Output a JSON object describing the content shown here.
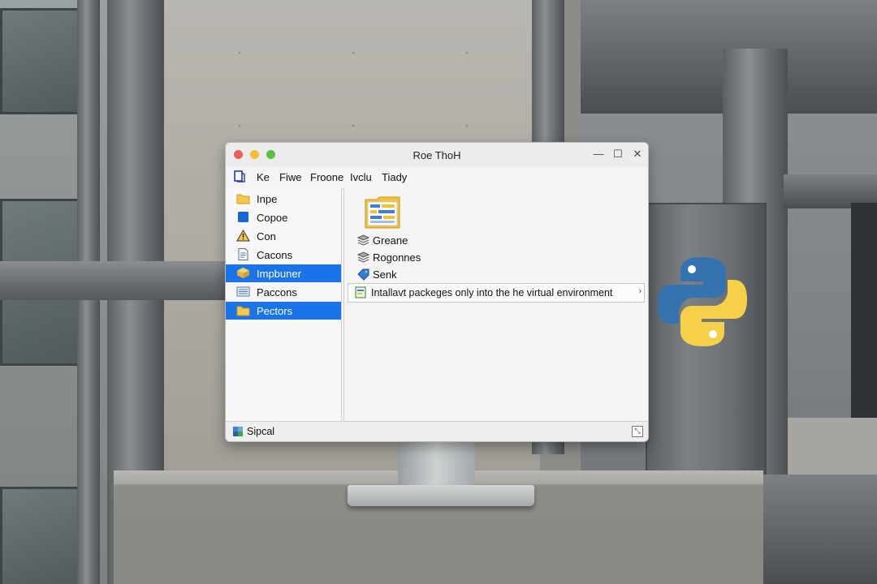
{
  "window": {
    "title": "Roe ThoH",
    "controls": {
      "minimize": "—",
      "maximize": "☐",
      "close": "✕"
    }
  },
  "menubar": {
    "items": [
      "Ke",
      "Fiwe",
      "Froone",
      "Ivclu",
      "Tiady"
    ]
  },
  "sidebar": {
    "items": [
      {
        "label": "Inpe",
        "icon": "folder-icon",
        "selected": false
      },
      {
        "label": "Copoe",
        "icon": "blue-square-icon",
        "selected": false
      },
      {
        "label": "Con",
        "icon": "warning-icon",
        "selected": false
      },
      {
        "label": "Cacons",
        "icon": "document-icon",
        "selected": false
      },
      {
        "label": "Impbuner",
        "icon": "package-icon",
        "selected": true
      },
      {
        "label": "Paccons",
        "icon": "list-icon",
        "selected": false
      },
      {
        "label": "Pectors",
        "icon": "folder-icon",
        "selected": true
      }
    ]
  },
  "content": {
    "items": [
      {
        "label": "Greane",
        "icon": "stack-icon"
      },
      {
        "label": "Rogonnes",
        "icon": "stack-icon"
      },
      {
        "label": "Senk",
        "icon": "tag-icon"
      }
    ],
    "tooltip": "Intallavt packeges only into the he virtual environment"
  },
  "statusbar": {
    "text": "Sipcal"
  },
  "colors": {
    "selection": "#1a73e8",
    "python_blue": "#3572b0",
    "python_yellow": "#f7d04a"
  }
}
